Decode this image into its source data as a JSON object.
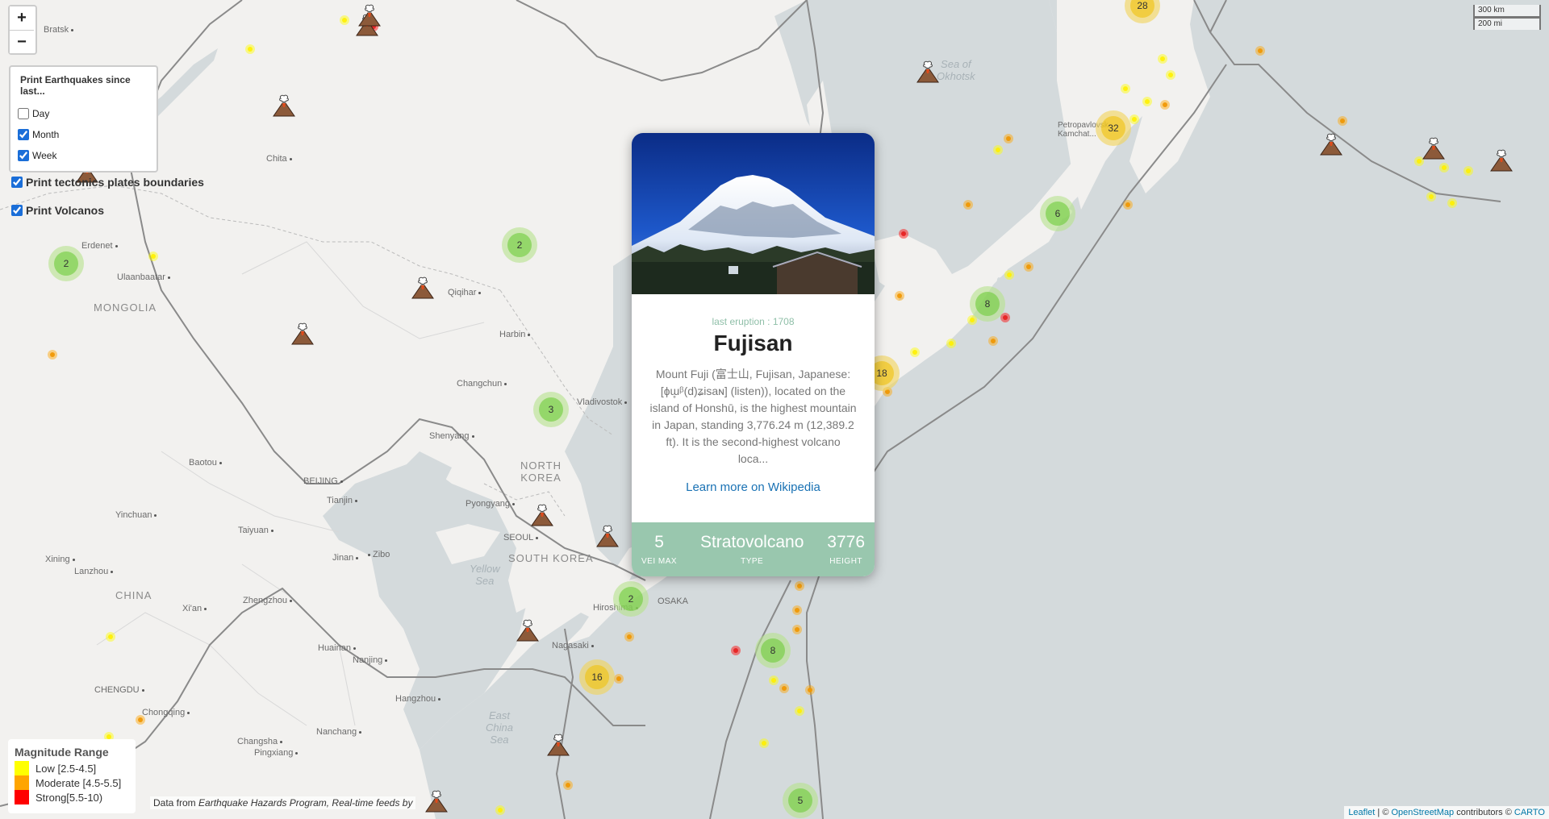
{
  "map": {
    "country_labels": [
      {
        "id": "mongolia",
        "text": "MONGOLIA"
      },
      {
        "id": "china",
        "text": "CHINA"
      },
      {
        "id": "north-korea",
        "text": "NORTH\nKOREA"
      },
      {
        "id": "south-korea",
        "text": "SOUTH KOREA"
      }
    ],
    "sea_labels": [
      {
        "id": "okhotsk",
        "text": "Sea of\nOkhotsk"
      },
      {
        "id": "yellow",
        "text": "Yellow\nSea"
      },
      {
        "id": "east-china",
        "text": "East\nChina\nSea"
      }
    ],
    "cities": [
      {
        "id": "bratsk",
        "text": "Bratsk"
      },
      {
        "id": "chita",
        "text": "Chita"
      },
      {
        "id": "erdenet",
        "text": "Erdenet"
      },
      {
        "id": "ulaanbaatar",
        "text": "Ulaanbaatar"
      },
      {
        "id": "qiqihar",
        "text": "Qiqihar"
      },
      {
        "id": "harbin",
        "text": "Harbin"
      },
      {
        "id": "changchun",
        "text": "Changchun"
      },
      {
        "id": "vladivostok",
        "text": "Vladivostok"
      },
      {
        "id": "shenyang",
        "text": "Shenyang"
      },
      {
        "id": "baotou",
        "text": "Baotou"
      },
      {
        "id": "beijing",
        "text": "BEIJING"
      },
      {
        "id": "tianjin",
        "text": "Tianjin"
      },
      {
        "id": "pyongyang",
        "text": "Pyongyang"
      },
      {
        "id": "seoul",
        "text": "SEOUL"
      },
      {
        "id": "yinchuan",
        "text": "Yinchuan"
      },
      {
        "id": "taiyuan",
        "text": "Taiyuan"
      },
      {
        "id": "jinan",
        "text": "Jinan"
      },
      {
        "id": "zibo",
        "text": "Zibo"
      },
      {
        "id": "xining",
        "text": "Xining"
      },
      {
        "id": "lanzhou",
        "text": "Lanzhou"
      },
      {
        "id": "zhengzhou",
        "text": "Zhengzhou"
      },
      {
        "id": "xian",
        "text": "Xi'an"
      },
      {
        "id": "huainan",
        "text": "Huainan"
      },
      {
        "id": "nanjing",
        "text": "Nanjing"
      },
      {
        "id": "chengdu",
        "text": "CHENGDU"
      },
      {
        "id": "hangzhou",
        "text": "Hangzhou"
      },
      {
        "id": "chongqing",
        "text": "Chongqing"
      },
      {
        "id": "nanchang",
        "text": "Nanchang"
      },
      {
        "id": "changsha",
        "text": "Changsha"
      },
      {
        "id": "pingxiang",
        "text": "Pingxiang"
      },
      {
        "id": "hiroshima",
        "text": "Hiroshima"
      },
      {
        "id": "osaka",
        "text": "OSAKA"
      },
      {
        "id": "nagasaki",
        "text": "Nagasaki"
      },
      {
        "id": "petropavlovsk",
        "text": "Petropavlovsk-\nKamchat..."
      }
    ],
    "clusters": [
      {
        "count": "2",
        "color": "green"
      },
      {
        "count": "2",
        "color": "green"
      },
      {
        "count": "3",
        "color": "green"
      },
      {
        "count": "2",
        "color": "green"
      },
      {
        "count": "8",
        "color": "green"
      },
      {
        "count": "5",
        "color": "green"
      },
      {
        "count": "6",
        "color": "green"
      },
      {
        "count": "8",
        "color": "green"
      },
      {
        "count": "16",
        "color": "yellow"
      },
      {
        "count": "18",
        "color": "yellow"
      },
      {
        "count": "32",
        "color": "yellow"
      },
      {
        "count": "28",
        "color": "yellow"
      }
    ],
    "earthquakes_low": 24,
    "earthquakes_moderate": 20,
    "earthquakes_strong": 4,
    "volcano_count": 15
  },
  "controls": {
    "zoom_in": "+",
    "zoom_out": "−",
    "quake_panel_title": "Print Earthquakes since last...",
    "quake_options": [
      {
        "label": "Day",
        "checked": false
      },
      {
        "label": "Month",
        "checked": true
      },
      {
        "label": "Week",
        "checked": true
      }
    ],
    "layer_options": [
      {
        "label": "Print tectonics plates boundaries",
        "checked": true
      },
      {
        "label": "Print Volcanos",
        "checked": true
      }
    ]
  },
  "popup": {
    "last_eruption": "last eruption : 1708",
    "name": "Fujisan",
    "description": "Mount Fuji (富士山, Fujisan, Japanese: [ɸɯ̥ᵝ(d)ʑisaɴ] (listen)), located on the island of Honshū, is the highest mountain in Japan, standing 3,776.24 m (12,389.2 ft). It is the second-highest volcano loca...",
    "wiki_link": "Learn more on Wikipedia",
    "stats": [
      {
        "value": "5",
        "key": "VEI MAX"
      },
      {
        "value": "Stratovolcano",
        "key": "TYPE"
      },
      {
        "value": "3776",
        "key": "HEIGHT"
      }
    ],
    "colors": {
      "accent": "#99c7ae",
      "link": "#1a72b4"
    }
  },
  "legend": {
    "title": "Magnitude Range",
    "items": [
      {
        "label": "Low [2.5-4.5]",
        "color": "#ffff00"
      },
      {
        "label": "Moderate [4.5-5.5]",
        "color": "#ffa500"
      },
      {
        "label": "Strong[5.5-10)",
        "color": "#ff0000"
      }
    ]
  },
  "attribution": {
    "bottom_prefix": "Data from ",
    "bottom_source": "Earthquake Hazards Program, Real-time feeds by",
    "right_leaflet": "Leaflet",
    "right_sep": " | © ",
    "right_osm": "OpenStreetMap",
    "right_contrib": " contributors © ",
    "right_carto": "CARTO"
  },
  "scale": {
    "km": "300 km",
    "mi": "200 mi"
  }
}
